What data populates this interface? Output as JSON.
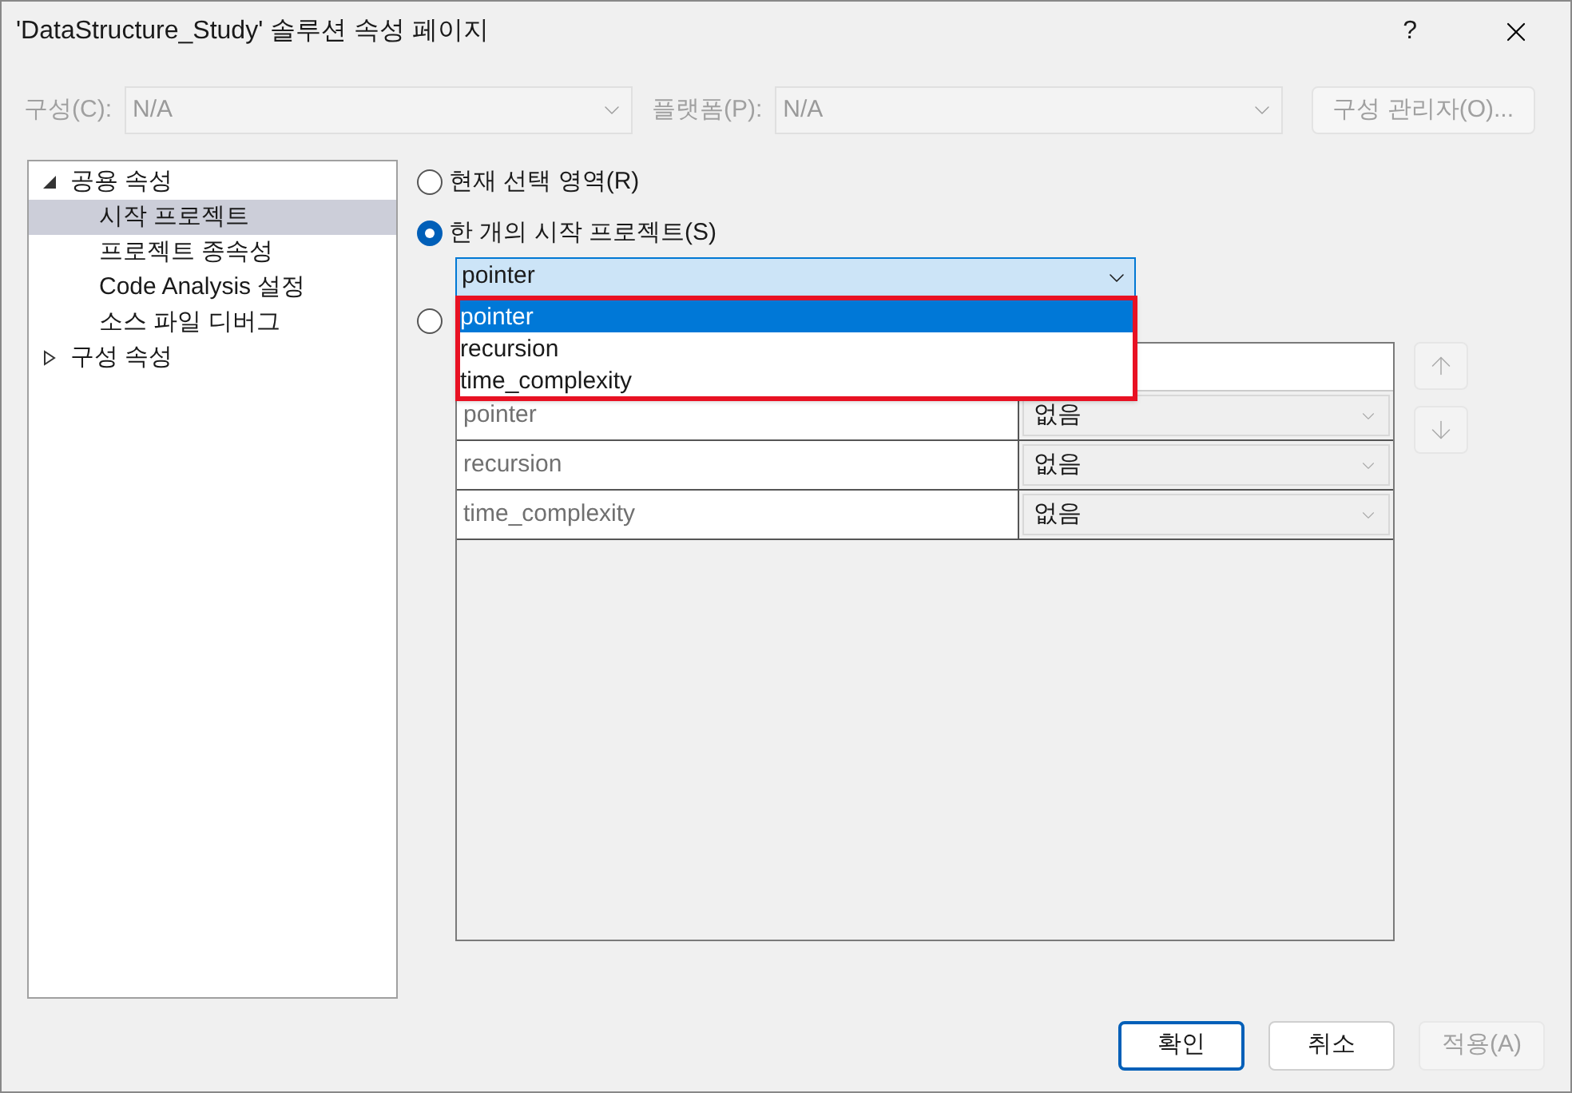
{
  "window": {
    "title": "'DataStructure_Study' 솔루션 속성 페이지",
    "help": "?"
  },
  "toolbar": {
    "configuration": {
      "label": "구성(C):",
      "value": "N/A"
    },
    "platform": {
      "label": "플랫폼(P):",
      "value": "N/A"
    },
    "manager_button": "구성 관리자(O)..."
  },
  "tree": [
    {
      "label": "공용 속성",
      "expanded": true,
      "children": [
        {
          "label": "시작 프로젝트",
          "selected": true
        },
        {
          "label": "프로젝트 종속성",
          "selected": false
        },
        {
          "label": "Code Analysis 설정",
          "selected": false
        },
        {
          "label": "소스 파일 디버그",
          "selected": false
        }
      ]
    },
    {
      "label": "구성 속성",
      "expanded": false
    }
  ],
  "startup_options": [
    {
      "label": "현재 선택 영역(R)",
      "selected": false
    },
    {
      "label": "한 개의 시작 프로젝트(S)",
      "selected": true
    },
    {
      "selected": false
    }
  ],
  "startup_combo": {
    "value": "pointer",
    "open": true
  },
  "dropdown_options": [
    {
      "label": "pointer",
      "selected": true
    },
    {
      "label": "recursion",
      "selected": false
    },
    {
      "label": "time_complexity",
      "selected": false
    }
  ],
  "table_rows": [
    {
      "project": "pointer",
      "action": "없음"
    },
    {
      "project": "recursion",
      "action": "없음"
    },
    {
      "project": "time_complexity",
      "action": "없음"
    }
  ],
  "buttons": [
    {
      "label": "확인",
      "kind": "default"
    },
    {
      "label": "취소",
      "kind": "normal"
    },
    {
      "label": "적용(A)",
      "kind": "disabled"
    }
  ]
}
